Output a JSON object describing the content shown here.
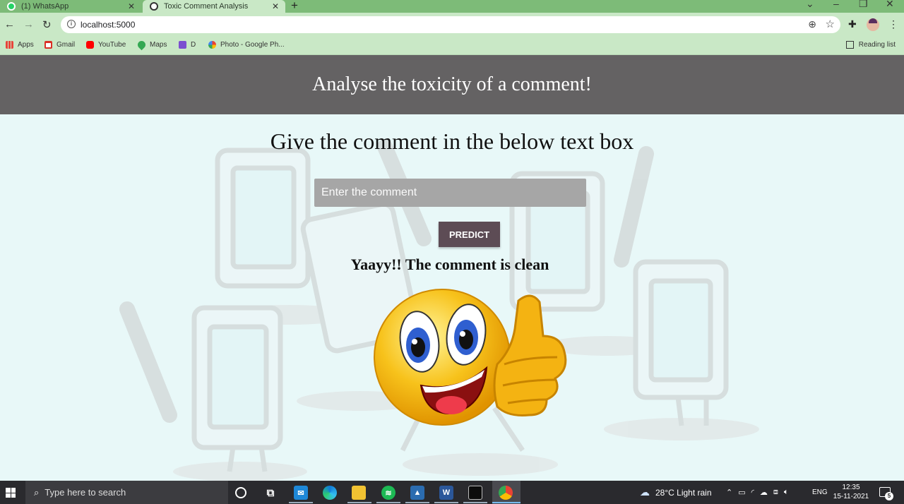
{
  "browser": {
    "tabs": [
      {
        "title": "(1) WhatsApp",
        "icon": "whatsapp-icon"
      },
      {
        "title": "Toxic Comment Analysis",
        "icon": "globe-icon"
      }
    ],
    "url": "localhost:5000",
    "bookmarks": [
      {
        "label": "Apps",
        "icon": "apps-grid-icon",
        "color": "#e8443a"
      },
      {
        "label": "Gmail",
        "icon": "gmail-icon",
        "color": "#d93025"
      },
      {
        "label": "YouTube",
        "icon": "youtube-icon",
        "color": "#ff0000"
      },
      {
        "label": "Maps",
        "icon": "maps-pin-icon",
        "color": "#34a853"
      },
      {
        "label": "D",
        "icon": "list-icon",
        "color": "#7b4fd0"
      },
      {
        "label": "Photo - Google Ph...",
        "icon": "google-photos-icon",
        "color": "#fbbc04"
      }
    ],
    "reading_list": "Reading list"
  },
  "page": {
    "header_title": "Analyse the toxicity of a comment!",
    "subtitle": "Give the comment in the below text box",
    "input_placeholder": "Enter the comment",
    "input_value": "",
    "predict_label": "PREDICT",
    "result_text": "Yaayy!! The comment is clean"
  },
  "taskbar": {
    "search_placeholder": "Type here to search",
    "weather": "28°C  Light rain",
    "language": "ENG",
    "time": "12:35",
    "date": "15-11-2021",
    "notification_count": "5"
  },
  "colors": {
    "header_bg": "#646263",
    "page_bg": "#e8f8f8",
    "button_bg": "#5d4c55",
    "input_bg": "#a6a6a6",
    "browser_accent": "#7dbb78"
  }
}
